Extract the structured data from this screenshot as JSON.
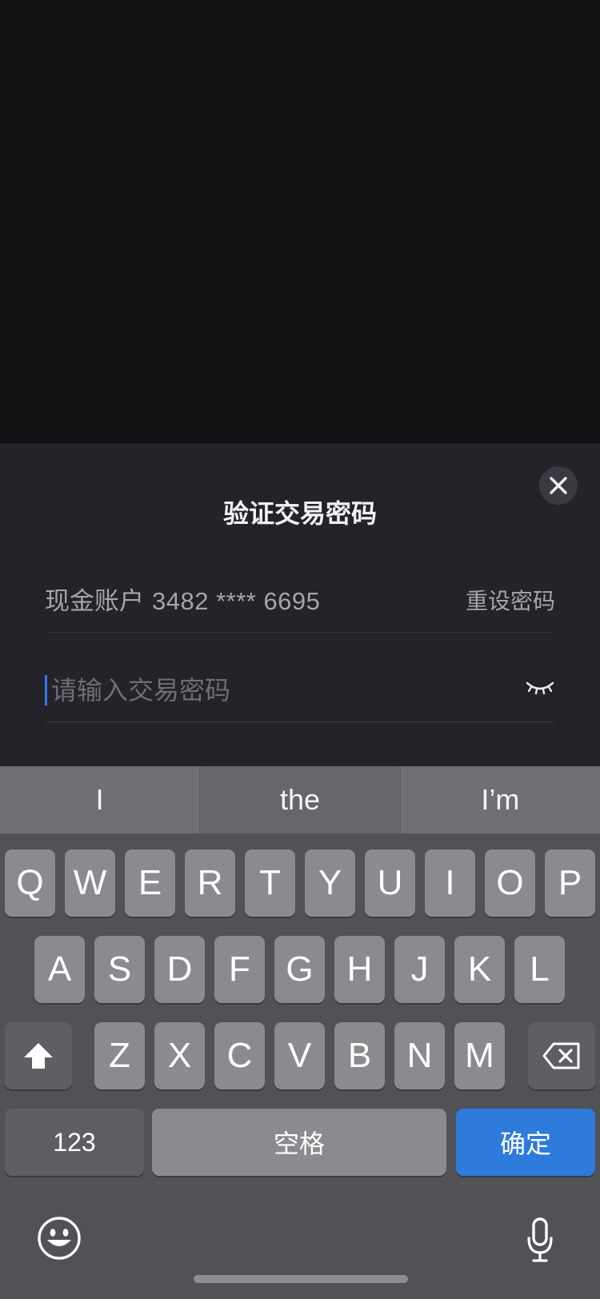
{
  "dialog": {
    "title": "验证交易密码",
    "close_icon": "close-icon",
    "account_label": "现金账户",
    "account_number": "3482 **** 6695",
    "reset_password": "重设密码",
    "password_placeholder": "请输入交易密码",
    "visibility_icon": "eye-closed-icon"
  },
  "keyboard": {
    "suggestions": [
      "I",
      "the",
      "I’m"
    ],
    "row1": [
      "Q",
      "W",
      "E",
      "R",
      "T",
      "Y",
      "U",
      "I",
      "O",
      "P"
    ],
    "row2": [
      "A",
      "S",
      "D",
      "F",
      "G",
      "H",
      "J",
      "K",
      "L"
    ],
    "row3": [
      "Z",
      "X",
      "C",
      "V",
      "B",
      "N",
      "M"
    ],
    "numbers_key": "123",
    "space_key": "空格",
    "confirm_key": "确定",
    "shift_icon": "shift-icon",
    "delete_icon": "backspace-icon",
    "emoji_icon": "emoji-icon",
    "mic_icon": "microphone-icon"
  },
  "colors": {
    "accent": "#2f7bdc",
    "sheet_bg": "#232329",
    "overlay_bg": "#121215"
  }
}
